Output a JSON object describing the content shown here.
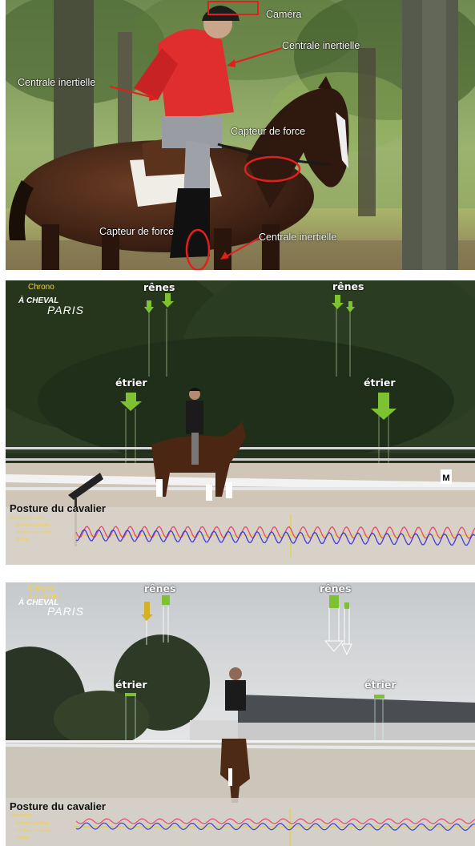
{
  "photo1": {
    "labels": {
      "camera": "Caméra",
      "inertial_top_right": "Centrale inertielle",
      "inertial_left": "Centrale inertielle",
      "force_bridle": "Capteur de force",
      "force_stirrup": "Capteur de force",
      "inertial_bottom": "Centrale inertielle"
    },
    "annotation_color": "#e0201c"
  },
  "video1": {
    "chrono_label": "Chrono",
    "brand_line1": "À CHEVAL",
    "brand_line2": "PARIS",
    "reins_left": "rênes",
    "reins_right": "rênes",
    "stirrup_left": "étrier",
    "stirrup_right": "étrier",
    "posture_title": "Posture du cavalier",
    "legend": [
      "Flexion-Extension",
      "Sternum Cavalier",
      "Lombaires cavalier",
      "Cheval"
    ],
    "arrow_color": "#7ec234"
  },
  "video2": {
    "chrono_label": "Chrono",
    "chrono_time": "00:11:06",
    "brand_line1": "À CHEVAL",
    "brand_line2": "PARIS",
    "reins_left": "rênes",
    "reins_right": "rênes",
    "stirrup_left": "étrier",
    "stirrup_right": "étrier",
    "posture_title": "Posture du cavalier",
    "legend_title": "Inclinaison",
    "legend": [
      "Sternum Cavalier",
      "Lombaires cavalier",
      "Cheval"
    ],
    "series_colors": {
      "sternum": "#e84a6a",
      "lumbar": "#3a3ee0",
      "horse": "#e6d21a"
    }
  }
}
